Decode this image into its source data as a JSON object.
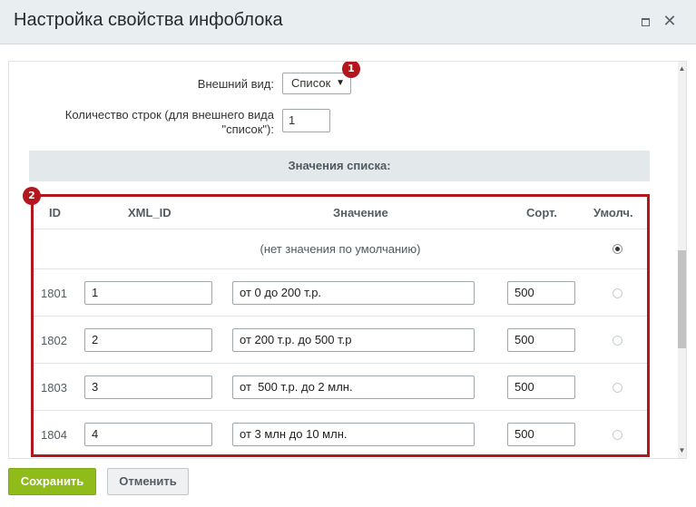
{
  "window": {
    "title": "Настройка свойства инфоблока",
    "maximize_icon": "maximize-icon",
    "close_icon": "close-icon",
    "close_glyph": "✕"
  },
  "form": {
    "view_label": "Внешний вид:",
    "view_value": "Список",
    "rows_label_line1": "Количество строк (для внешнего вида",
    "rows_label_line2": "\"список\"):",
    "rows_value": "1"
  },
  "badges": [
    "1",
    "2"
  ],
  "list_section": {
    "heading": "Значения списка:",
    "columns": [
      "ID",
      "XML_ID",
      "Значение",
      "Сорт.",
      "Умолч."
    ],
    "no_default_text": "(нет значения по умолчанию)",
    "rows": [
      {
        "id": "1801",
        "xml_id": "1",
        "value": "от 0 до 200 т.р.",
        "sort": "500"
      },
      {
        "id": "1802",
        "xml_id": "2",
        "value": "от 200 т.р. до 500 т.р",
        "sort": "500"
      },
      {
        "id": "1803",
        "xml_id": "3",
        "value": "от  500 т.р. до 2 млн.",
        "sort": "500"
      },
      {
        "id": "1804",
        "xml_id": "4",
        "value": "от 3 млн до 10 млн.",
        "sort": "500"
      }
    ]
  },
  "footer": {
    "save_label": "Сохранить",
    "cancel_label": "Отменить"
  },
  "colors": {
    "accent_green": "#8fbc1b",
    "highlight_red": "#b3161d",
    "titlebar_bg": "#e9eef0"
  }
}
